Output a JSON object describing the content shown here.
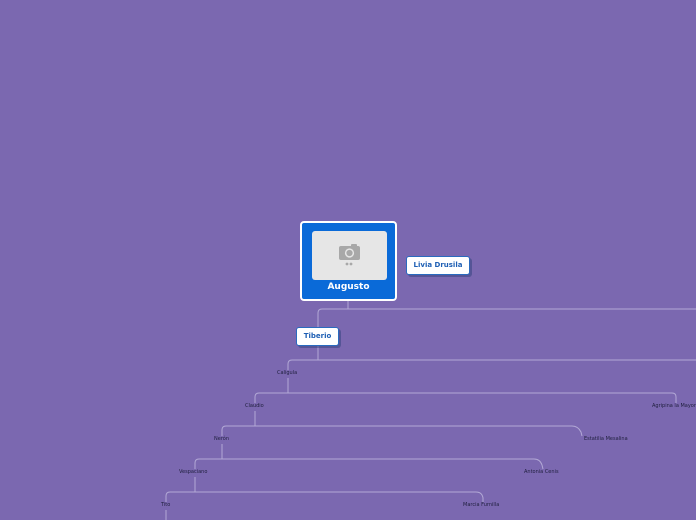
{
  "colors": {
    "background": "#7b68b0",
    "root_fill": "#0a6ad8",
    "root_border": "#ffffff",
    "node_border": "#2a6bbf",
    "node_text": "#1e5fb4",
    "connector": "#b3a9d6",
    "label_text": "#1e1e3c"
  },
  "root": {
    "label": "Augusto",
    "image_icon": "camera-icon"
  },
  "nodes": {
    "livia": "Livia Drusila",
    "tiberio": "Tiberio",
    "caligula": "Caligula",
    "claudio": "Claudio",
    "agripina": "Agripina la Mayor",
    "neron": "Nerón",
    "estatilia": "Estatilia Mesalina",
    "vespaciano": "Vespaciano",
    "antonia": "Antonia Cenis",
    "tito": "Tito",
    "marcia": "Marcia Furnilla"
  }
}
